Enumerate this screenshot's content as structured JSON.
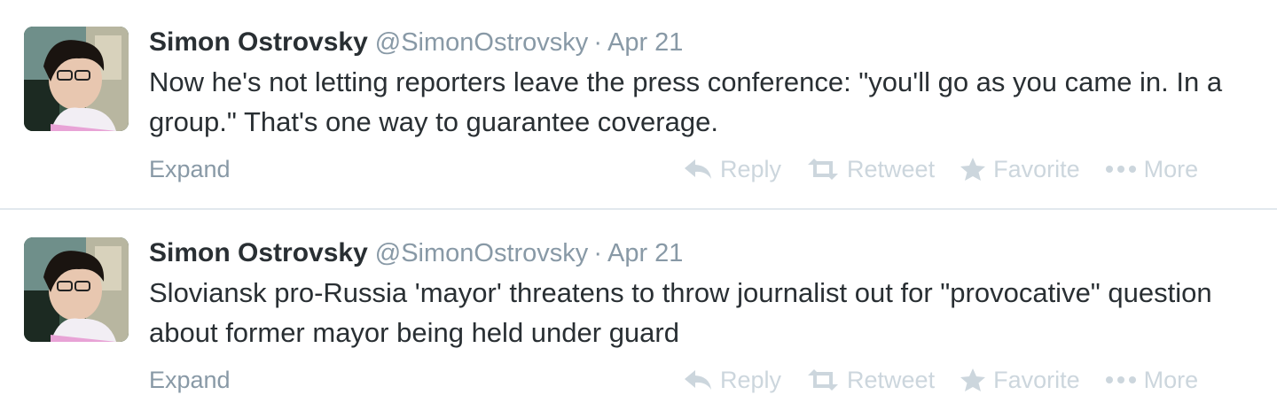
{
  "tweets": [
    {
      "author_name": "Simon Ostrovsky",
      "handle": "@SimonOstrovsky",
      "separator": "·",
      "time": "Apr 21",
      "text": "Now he's not letting reporters leave the press conference: \"you'll go as you came in. In a group.\" That's one way to guarantee coverage.",
      "expand_label": "Expand",
      "actions": {
        "reply": "Reply",
        "retweet": "Retweet",
        "favorite": "Favorite",
        "more": "More"
      }
    },
    {
      "author_name": "Simon Ostrovsky",
      "handle": "@SimonOstrovsky",
      "separator": "·",
      "time": "Apr 21",
      "text": "Sloviansk pro-Russia 'mayor' threatens to throw journalist out for \"provocative\" question about former mayor being held under guard",
      "expand_label": "Expand",
      "actions": {
        "reply": "Reply",
        "retweet": "Retweet",
        "favorite": "Favorite",
        "more": "More"
      }
    }
  ],
  "icons": {
    "reply": "reply-icon",
    "retweet": "retweet-icon",
    "favorite": "star-icon",
    "more": "more-dots-icon"
  },
  "colors": {
    "name": "#292f33",
    "meta": "#8899a6",
    "action": "#ccd6dd",
    "divider": "#e1e8ed"
  }
}
